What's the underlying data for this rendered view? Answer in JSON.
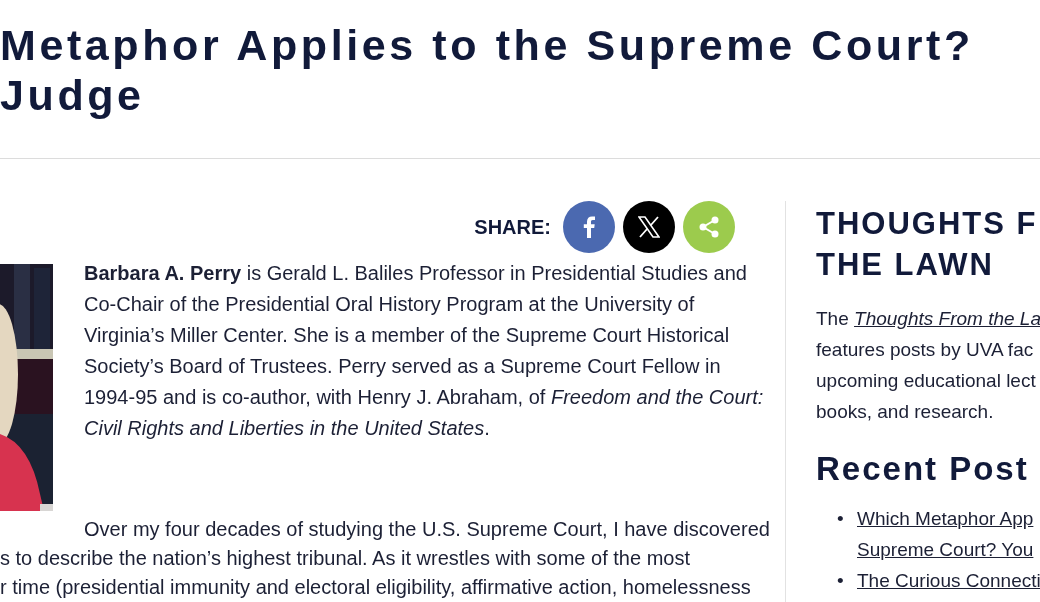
{
  "article_title": {
    "lines": [
      "Metaphor Applies to the Supreme Court?",
      "Judge"
    ]
  },
  "share": {
    "label": "SHARE:",
    "buttons": [
      {
        "kind": "facebook"
      },
      {
        "kind": "x"
      },
      {
        "kind": "share"
      }
    ]
  },
  "author_bio": {
    "text": "**Barbara A. Perry** is Gerald L. Baliles Professor in Presidential Studies and Co-Chair of the Presidential Oral History Program at the University of Virginia’s Miller Center. She is a member of the Supreme Court Historical Society’s Board of Trustees. Perry served as a Supreme Court Fellow in 1994-95 and is co-author, with Henry J. Abraham, of *Freedom and the Court: Civil Rights and Liberties in the United States*."
  },
  "article_body": {
    "lines": [
      "Over my four decades of studying the U.S. Supreme Court, I have discovered",
      "s to describe the nation’s highest tribunal. As it wrestles with some of the most",
      "r time (presidential immunity and electoral eligibility, affirmative action, homelessness"
    ]
  },
  "sidebar": {
    "title_lines": [
      "THOUGHTS F",
      "THE LAWN"
    ],
    "intro": {
      "prefix": "The",
      "link": "Thoughts From the La",
      "lines": [
        "features posts by UVA fac",
        "upcoming educational lect",
        "books, and research."
      ]
    },
    "recent_posts": {
      "title": "Recent Post",
      "items": [
        {
          "marker": "•",
          "lines": [
            "Which Metaphor App",
            "Supreme Court? You"
          ]
        },
        {
          "marker": "•",
          "lines": [
            "The Curious Connecti"
          ]
        }
      ]
    }
  }
}
